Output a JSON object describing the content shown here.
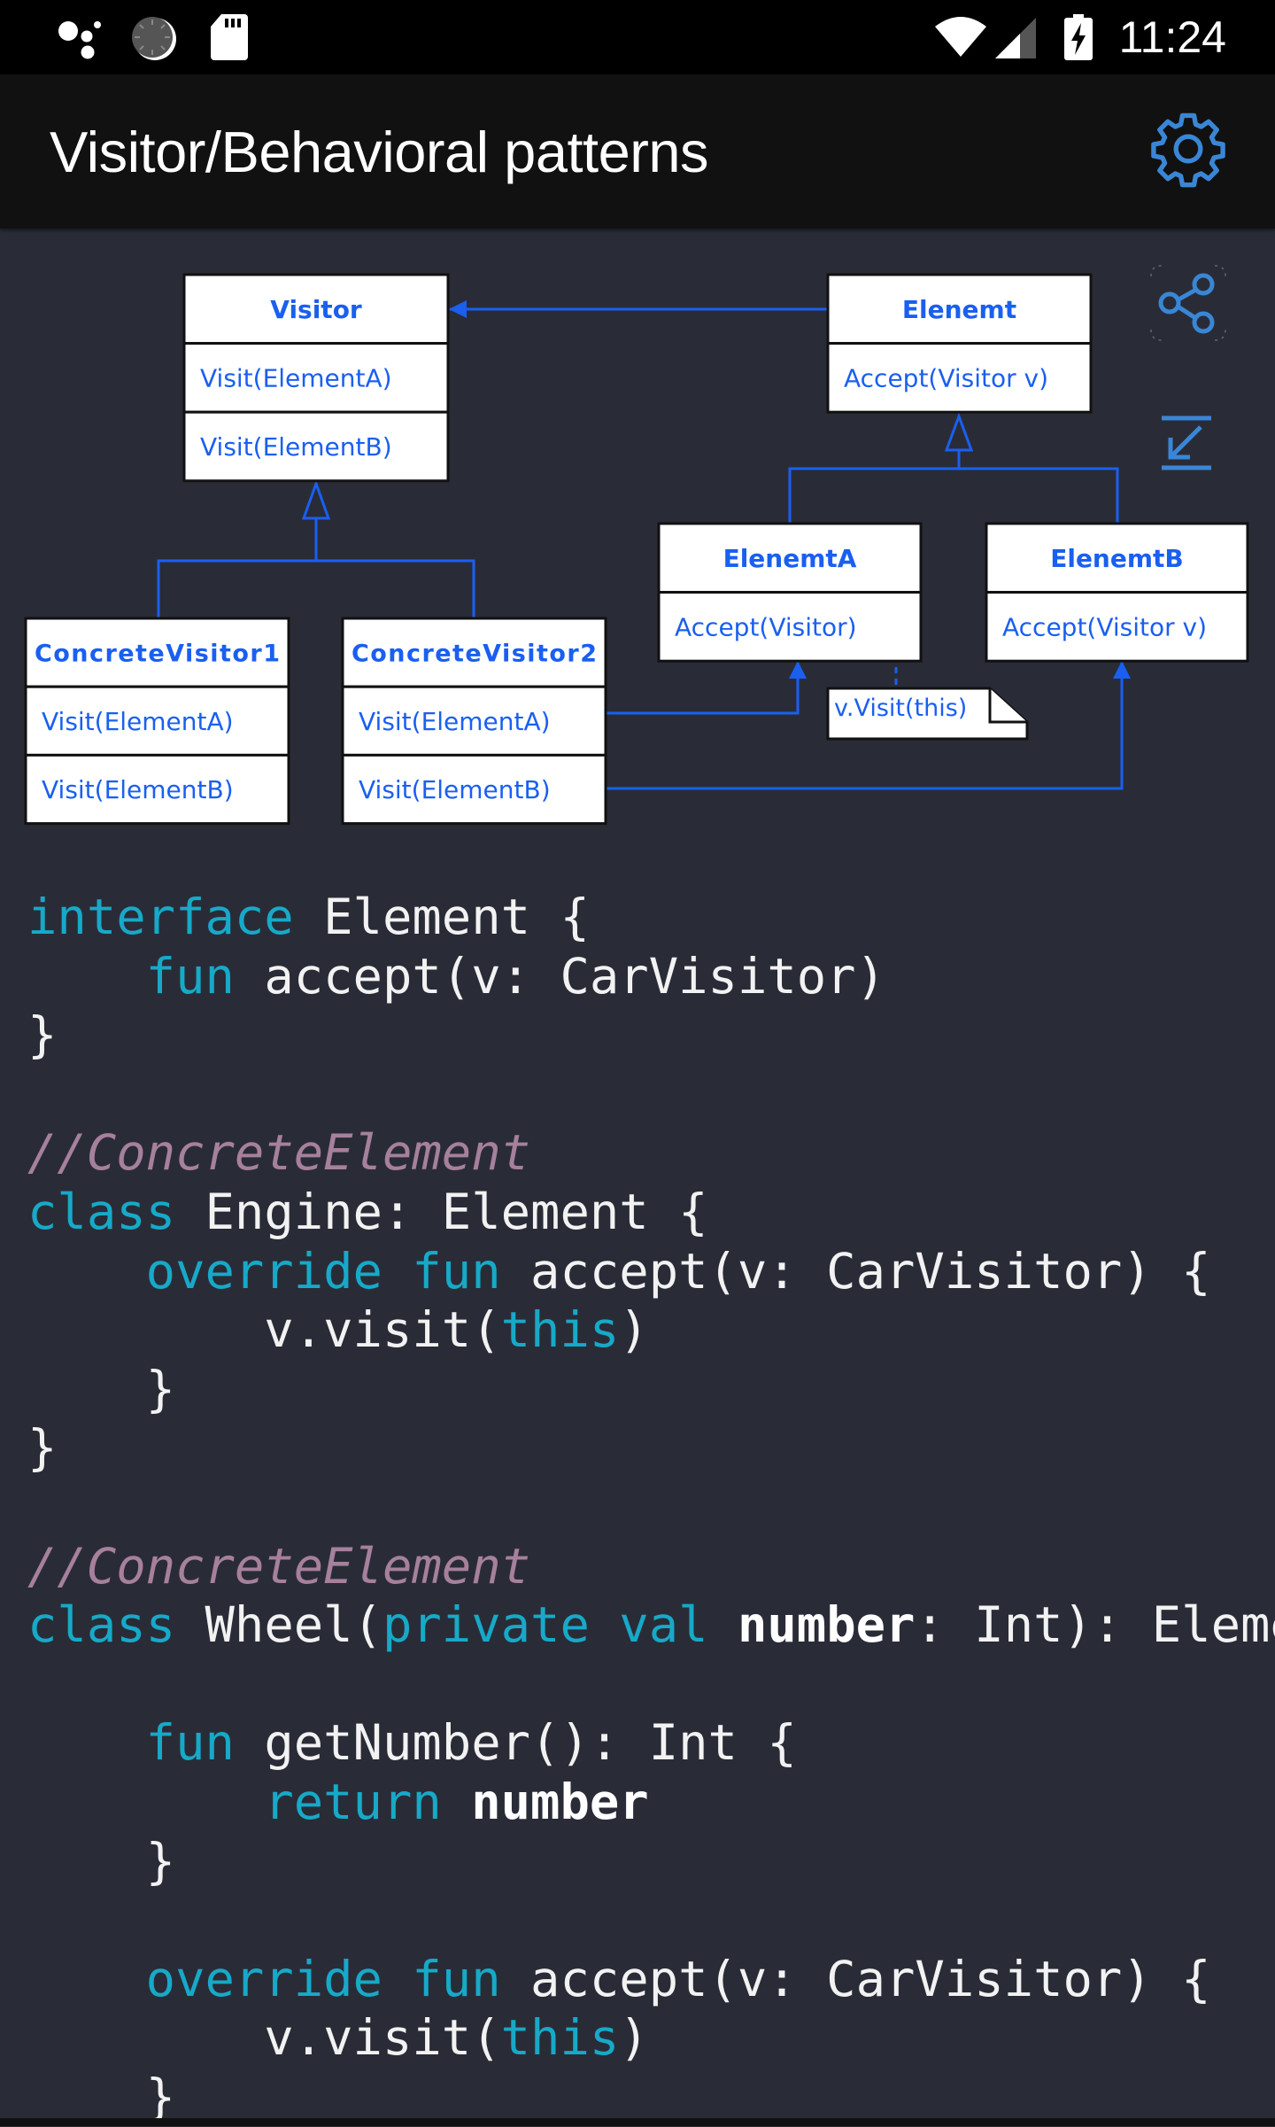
{
  "status_bar": {
    "time": "11:24",
    "left_icons": [
      "assistant-dots-icon",
      "sync-progress-icon",
      "sd-card-icon"
    ],
    "right_icons": [
      "wifi-icon",
      "cell-signal-icon",
      "battery-charging-icon"
    ]
  },
  "app_bar": {
    "title": "Visitor/Behavioral patterns",
    "settings_icon": "gear-icon"
  },
  "colors": {
    "accent": "#3a86d6",
    "diagram_blue": "#1a5ff0",
    "keyword": "#17a9c8",
    "comment": "#a6809c",
    "background": "#292c37"
  },
  "diagram": {
    "boxes": [
      {
        "id": "visitor",
        "title": "Visitor",
        "methods": [
          "Visit(ElementA)",
          "Visit(ElementB)"
        ]
      },
      {
        "id": "element",
        "title": "Elenemt",
        "methods": [
          "Accept(Visitor v)"
        ]
      },
      {
        "id": "element-a",
        "title": "ElenemtA",
        "methods": [
          "Accept(Visitor)"
        ]
      },
      {
        "id": "element-b",
        "title": "ElenemtB",
        "methods": [
          "Accept(Visitor v)"
        ]
      },
      {
        "id": "concrete-visitor-1",
        "title": "ConcreteVisitor1",
        "methods": [
          "Visit(ElementA)",
          "Visit(ElementB)"
        ]
      },
      {
        "id": "concrete-visitor-2",
        "title": "ConcreteVisitor2",
        "methods": [
          "Visit(ElementA)",
          "Visit(ElementB)"
        ]
      }
    ],
    "note": "v.Visit(this)",
    "actions": {
      "share_icon": "share-icon",
      "collapse_icon": "collapse-arrow-icon"
    }
  },
  "code": {
    "language": "kotlin",
    "lines": [
      [
        {
          "t": "interface",
          "k": "kw"
        },
        {
          "t": " Element {"
        }
      ],
      [
        {
          "t": "    "
        },
        {
          "t": "fun",
          "k": "kw"
        },
        {
          "t": " accept(v: CarVisitor)"
        }
      ],
      [
        {
          "t": "}"
        }
      ],
      [
        {
          "t": ""
        }
      ],
      [
        {
          "t": "//ConcreteElement",
          "k": "cm"
        }
      ],
      [
        {
          "t": "class",
          "k": "kw"
        },
        {
          "t": " Engine: Element {"
        }
      ],
      [
        {
          "t": "    "
        },
        {
          "t": "override fun",
          "k": "kw"
        },
        {
          "t": " accept(v: CarVisitor) {"
        }
      ],
      [
        {
          "t": "        v.visit("
        },
        {
          "t": "this",
          "k": "kw"
        },
        {
          "t": ")"
        }
      ],
      [
        {
          "t": "    }"
        }
      ],
      [
        {
          "t": "}"
        }
      ],
      [
        {
          "t": ""
        }
      ],
      [
        {
          "t": "//ConcreteElement",
          "k": "cm"
        }
      ],
      [
        {
          "t": "class",
          "k": "kw"
        },
        {
          "t": " Wheel("
        },
        {
          "t": "private val",
          "k": "kw"
        },
        {
          "t": " "
        },
        {
          "t": "number",
          "k": "bold"
        },
        {
          "t": ": Int): Element {"
        }
      ],
      [
        {
          "t": ""
        }
      ],
      [
        {
          "t": "    "
        },
        {
          "t": "fun",
          "k": "kw"
        },
        {
          "t": " getNumber(): Int {"
        }
      ],
      [
        {
          "t": "        "
        },
        {
          "t": "return",
          "k": "kw"
        },
        {
          "t": " "
        },
        {
          "t": "number",
          "k": "bold"
        }
      ],
      [
        {
          "t": "    }"
        }
      ],
      [
        {
          "t": ""
        }
      ],
      [
        {
          "t": "    "
        },
        {
          "t": "override fun",
          "k": "kw"
        },
        {
          "t": " accept(v: CarVisitor) {"
        }
      ],
      [
        {
          "t": "        v.visit("
        },
        {
          "t": "this",
          "k": "kw"
        },
        {
          "t": ")"
        }
      ],
      [
        {
          "t": "    }"
        }
      ]
    ]
  }
}
